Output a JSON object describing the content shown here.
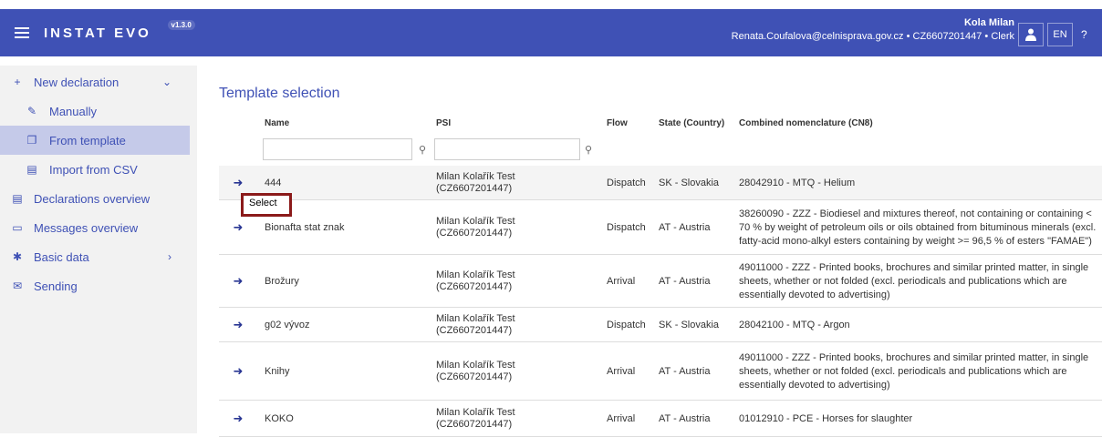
{
  "app": {
    "title": "INSTAT EVO",
    "version": "v1.3.0"
  },
  "header": {
    "user_name": "Kola Milan",
    "user_info": "Renata.Coufalova@celnisprava.gov.cz • CZ6607201447 • Clerk",
    "lang": "EN",
    "help_glyph": "?"
  },
  "sidebar": {
    "new_declaration": "New declaration",
    "manually": "Manually",
    "from_template": "From template",
    "import_csv": "Import from CSV",
    "declarations_overview": "Declarations overview",
    "messages_overview": "Messages overview",
    "basic_data": "Basic data",
    "sending": "Sending"
  },
  "main": {
    "title": "Template selection",
    "columns": {
      "name": "Name",
      "psi": "PSI",
      "flow": "Flow",
      "state": "State (Country)",
      "cn8": "Combined nomenclature (CN8)"
    },
    "tooltip": "Select",
    "rows": [
      {
        "name": "444",
        "psi1": "Milan Kolařík Test",
        "psi2": "(CZ6607201447)",
        "flow": "Dispatch",
        "state": "SK - Slovakia",
        "cn8": "28042910 - MTQ - Helium"
      },
      {
        "name": "Bionafta stat znak",
        "psi1": "Milan Kolařík Test",
        "psi2": "(CZ6607201447)",
        "flow": "Dispatch",
        "state": "AT - Austria",
        "cn8": "38260090 - ZZZ - Biodiesel and mixtures thereof, not containing or containing < 70 % by weight of petroleum oils or oils obtained from bituminous minerals (excl. fatty-acid mono-alkyl esters containing by weight >= 96,5 % of esters \"FAMAE\")"
      },
      {
        "name": "Brožury",
        "psi1": "Milan Kolařík Test",
        "psi2": "(CZ6607201447)",
        "flow": "Arrival",
        "state": "AT - Austria",
        "cn8": "49011000 - ZZZ - Printed books, brochures and similar printed matter, in single sheets, whether or not folded (excl. periodicals and publications which are essentially devoted to advertising)"
      },
      {
        "name": "g02 vývoz",
        "psi1": "Milan Kolařík Test",
        "psi2": "(CZ6607201447)",
        "flow": "Dispatch",
        "state": "SK - Slovakia",
        "cn8": "28042100 - MTQ - Argon"
      },
      {
        "name": "Knihy",
        "psi1": "Milan Kolařík Test",
        "psi2": "(CZ6607201447)",
        "flow": "Arrival",
        "state": "AT - Austria",
        "cn8": "49011000 - ZZZ - Printed books, brochures and similar printed matter, in single sheets, whether or not folded (excl. periodicals and publications which are essentially devoted to advertising)"
      },
      {
        "name": "KOKO",
        "psi1": "Milan Kolařík Test",
        "psi2": "(CZ6607201447)",
        "flow": "Arrival",
        "state": "AT - Austria",
        "cn8": "01012910 - PCE - Horses for slaughter"
      }
    ]
  }
}
